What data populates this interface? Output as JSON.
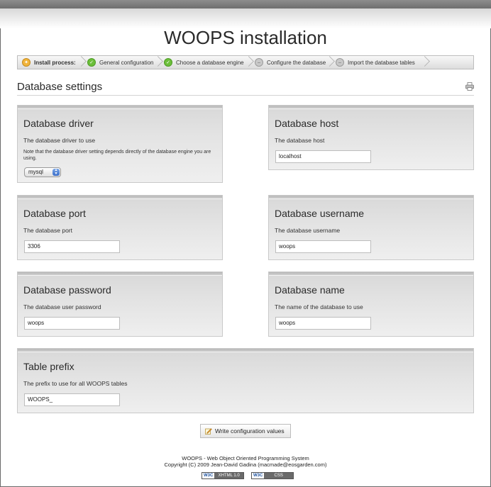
{
  "header": {
    "title": "WOOPS installation"
  },
  "breadcrumb": {
    "items": [
      {
        "label": "Install process:",
        "status": "start",
        "icon": "install-icon"
      },
      {
        "label": "General configuration",
        "status": "done",
        "icon": "check-icon"
      },
      {
        "label": "Choose a database engine",
        "status": "done",
        "icon": "check-icon"
      },
      {
        "label": "Configure the database",
        "status": "pending",
        "icon": "pending-icon"
      },
      {
        "label": "Import the database tables",
        "status": "pending",
        "icon": "pending-icon"
      }
    ]
  },
  "section": {
    "title": "Database settings",
    "icon": "print-icon"
  },
  "panels": {
    "driver": {
      "title": "Database driver",
      "description": "The database driver to use",
      "note": "Note that the database driver setting depends directly of the database engine you are using.",
      "value": "mysql"
    },
    "host": {
      "title": "Database host",
      "description": "The database host",
      "value": "localhost"
    },
    "port": {
      "title": "Database port",
      "description": "The database port",
      "value": "3306"
    },
    "username": {
      "title": "Database username",
      "description": "The database username",
      "value": "woops"
    },
    "password": {
      "title": "Database password",
      "description": "The database user password",
      "value": "woops"
    },
    "dbname": {
      "title": "Database name",
      "description": "The name of the database to use",
      "value": "woops"
    },
    "prefix": {
      "title": "Table prefix",
      "description": "The prefix to use for all WOOPS tables",
      "value": "WOOPS_"
    }
  },
  "actions": {
    "submit_label": "Write configuration values"
  },
  "footer": {
    "line1": "WOOPS - Web Object Oriented Programming System",
    "line2": "Copyright (C) 2009 Jean-David Gadina (macmade@eosgarden.com)",
    "badges": [
      {
        "left": "W3C",
        "right": "XHTML 1.0"
      },
      {
        "left": "W3C",
        "right": "CSS"
      }
    ]
  },
  "colors": {
    "check": "#6cbf3a",
    "pending": "#c9c9c9",
    "panel": "#e3e3e3"
  }
}
